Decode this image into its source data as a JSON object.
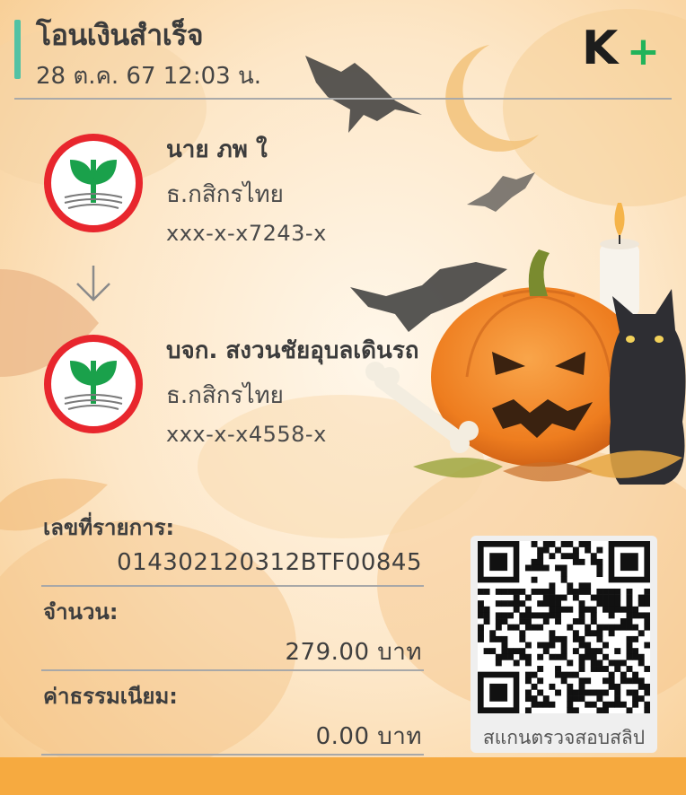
{
  "header": {
    "title": "โอนเงินสำเร็จ",
    "datetime": "28 ต.ค. 67  12:03 น.",
    "logo_letter": "K",
    "logo_plus": "+"
  },
  "sender": {
    "name": "นาย ภพ ใ",
    "bank": "ธ.กสิกรไทย",
    "account": "xxx-x-x7243-x"
  },
  "receiver": {
    "name": "บจก. สงวนชัยอุบลเดินรถ",
    "bank": "ธ.กสิกรไทย",
    "account": "xxx-x-x4558-x"
  },
  "details": {
    "ref_label": "เลขที่รายการ:",
    "ref_value": "014302120312BTF00845",
    "amount_label": "จำนวน:",
    "amount_value": "279.00 บาท",
    "fee_label": "ค่าธรรมเนียม:",
    "fee_value": "0.00 บาท"
  },
  "qr": {
    "caption": "สแกนตรวจสอบสลิป"
  },
  "colors": {
    "accent_bar": "#52c2a4",
    "brand_green": "#22b35a",
    "kbank_green": "#1aa14b",
    "kbank_red": "#e8262d",
    "footer": "#f6aa40"
  },
  "icons": [
    "kbank-logo-icon",
    "arrow-down-icon",
    "qr-code-icon",
    "halloween-background-illustration"
  ]
}
